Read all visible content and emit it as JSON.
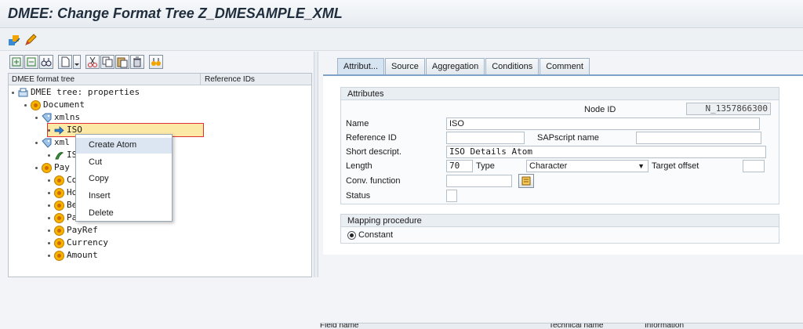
{
  "window": {
    "title": "DMEE: Change Format Tree Z_DMESAMPLE_XML"
  },
  "toolbar": {
    "icons": [
      "display-change-icon",
      "edit-pencil-icon"
    ]
  },
  "tree_toolbar": {
    "icons": [
      "expand-all-icon",
      "collapse-all-icon",
      "find-icon",
      "new-node-icon",
      "node-dropdown-icon",
      "cut-icon",
      "copy-icon",
      "paste-icon",
      "delete-icon",
      "where-used-icon"
    ]
  },
  "tree": {
    "columns": [
      "DMEE format tree",
      "Reference IDs"
    ],
    "nodes": [
      {
        "label": "DMEE tree: properties",
        "icon": "tree-properties-icon"
      },
      {
        "label": "Document",
        "icon": "element-icon"
      },
      {
        "label": "xmlns",
        "icon": "attribute-icon"
      },
      {
        "label": "ISO",
        "icon": "atom-arrow-icon"
      },
      {
        "label": "xml",
        "icon": "attribute-icon"
      },
      {
        "label": "IS",
        "icon": "atom-green-icon"
      },
      {
        "label": "Pay",
        "icon": "element-icon"
      },
      {
        "label": "Co",
        "icon": "element-icon"
      },
      {
        "label": "Ho",
        "icon": "element-icon"
      },
      {
        "label": "Be",
        "icon": "element-icon"
      },
      {
        "label": "PayeeName",
        "icon": "element-icon"
      },
      {
        "label": "PayRef",
        "icon": "element-icon"
      },
      {
        "label": "Currency",
        "icon": "element-icon"
      },
      {
        "label": "Amount",
        "icon": "element-icon"
      }
    ]
  },
  "context_menu": {
    "items": [
      "Create Atom",
      "Cut",
      "Copy",
      "Insert",
      "Delete"
    ]
  },
  "tabs": [
    "Attribut...",
    "Source",
    "Aggregation",
    "Conditions",
    "Comment"
  ],
  "attributes": {
    "group_title": "Attributes",
    "node_id_label": "Node ID",
    "node_id_value": "N_1357866300",
    "name_label": "Name",
    "name_value": "ISO",
    "reference_id_label": "Reference ID",
    "reference_id_value": "",
    "sapscript_label": "SAPscript name",
    "sapscript_value": "",
    "short_descr_label": "Short descript.",
    "short_descr_value": "ISO Details Atom",
    "length_label": "Length",
    "length_value": "70",
    "type_label": "Type",
    "type_value": "Character",
    "target_offset_label": "Target offset",
    "target_offset_value": "",
    "conv_function_label": "Conv. function",
    "conv_function_value": "",
    "status_label": "Status",
    "status_value": ""
  },
  "mapping": {
    "group_title": "Mapping procedure",
    "option": "Constant",
    "selected": true
  },
  "bottom_table": {
    "columns": [
      "Field name",
      "Technical name",
      "Information"
    ]
  },
  "colors": {
    "title_text": "#1f2d3d",
    "selection_outline": "#dd3333",
    "tab_active": "#d6e3f0",
    "node_orange": "#f4b400"
  }
}
